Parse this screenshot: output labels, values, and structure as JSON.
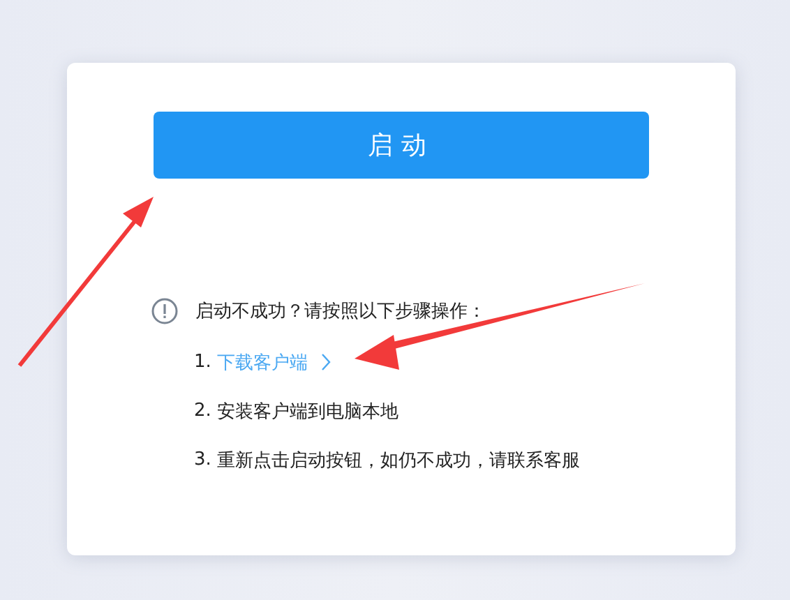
{
  "button": {
    "label": "启动"
  },
  "notice": {
    "text": "启动不成功？请按照以下步骤操作："
  },
  "steps": [
    {
      "number": "1.",
      "label": "下载客户端",
      "kind": "link"
    },
    {
      "number": "2.",
      "label": "安装客户端到电脑本地",
      "kind": "text"
    },
    {
      "number": "3.",
      "label": "重新点击启动按钮，如仍不成功，请联系客服",
      "kind": "text"
    }
  ]
}
